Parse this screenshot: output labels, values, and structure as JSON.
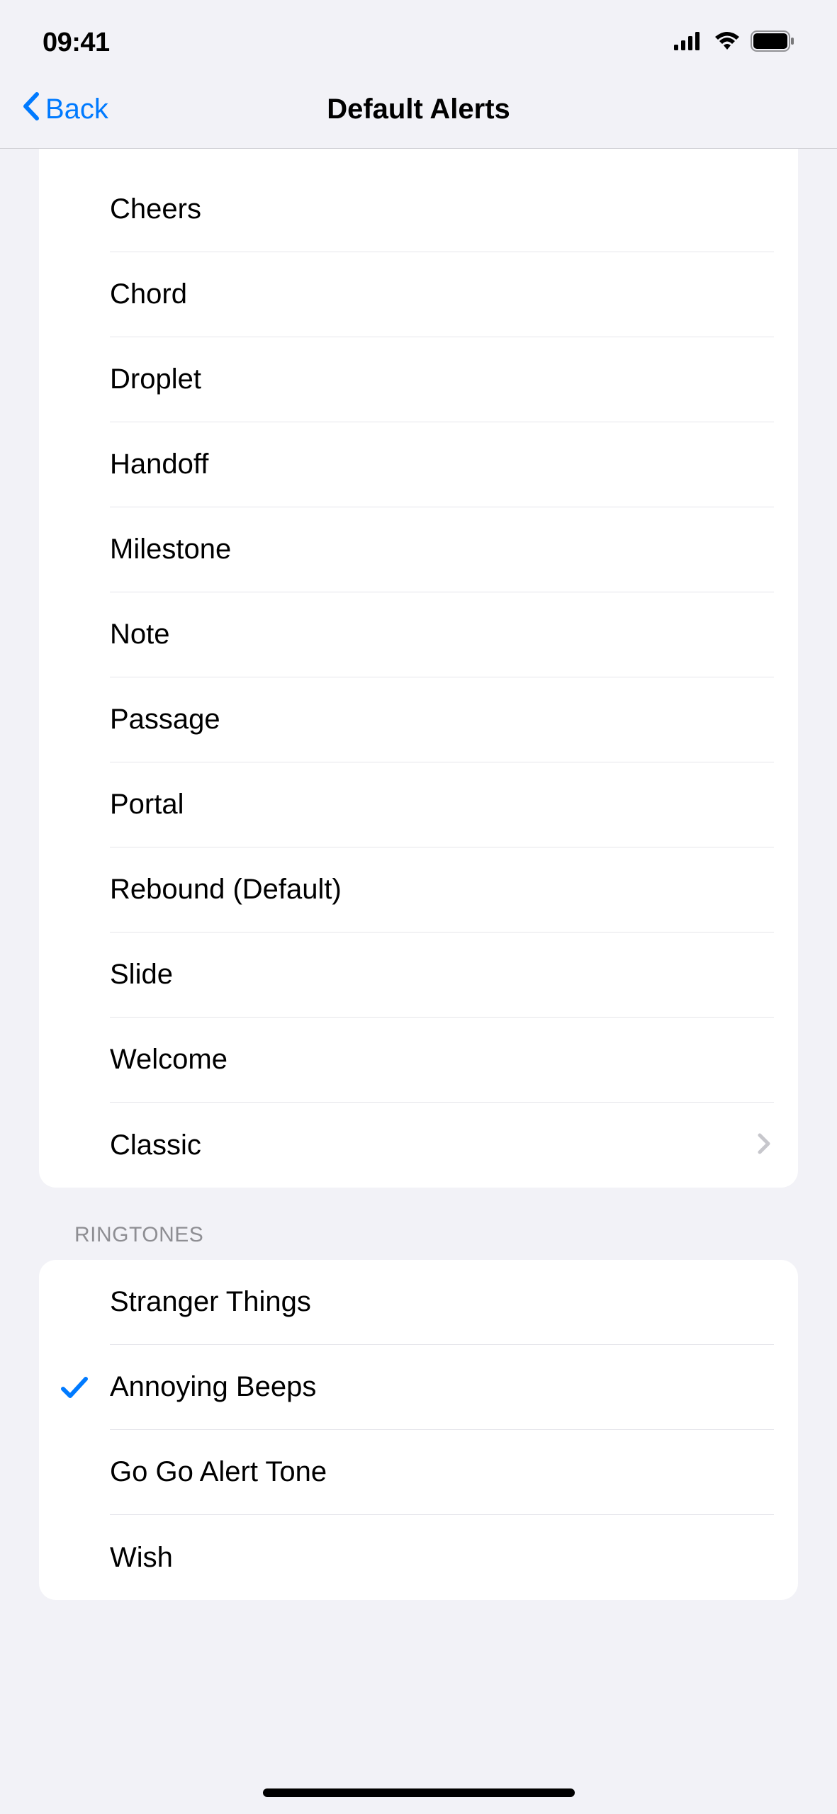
{
  "status": {
    "time": "09:41"
  },
  "nav": {
    "back_label": "Back",
    "title": "Default Alerts"
  },
  "alerts_section": {
    "items": [
      {
        "label": "Cheers",
        "selected": false,
        "disclosure": false
      },
      {
        "label": "Chord",
        "selected": false,
        "disclosure": false
      },
      {
        "label": "Droplet",
        "selected": false,
        "disclosure": false
      },
      {
        "label": "Handoff",
        "selected": false,
        "disclosure": false
      },
      {
        "label": "Milestone",
        "selected": false,
        "disclosure": false
      },
      {
        "label": "Note",
        "selected": false,
        "disclosure": false
      },
      {
        "label": "Passage",
        "selected": false,
        "disclosure": false
      },
      {
        "label": "Portal",
        "selected": false,
        "disclosure": false
      },
      {
        "label": "Rebound (Default)",
        "selected": false,
        "disclosure": false
      },
      {
        "label": "Slide",
        "selected": false,
        "disclosure": false
      },
      {
        "label": "Welcome",
        "selected": false,
        "disclosure": false
      },
      {
        "label": "Classic",
        "selected": false,
        "disclosure": true
      }
    ]
  },
  "ringtones_section": {
    "header": "Ringtones",
    "items": [
      {
        "label": "Stranger Things",
        "selected": false
      },
      {
        "label": "Annoying Beeps",
        "selected": true
      },
      {
        "label": "Go Go Alert Tone",
        "selected": false
      },
      {
        "label": "Wish",
        "selected": false
      }
    ]
  }
}
